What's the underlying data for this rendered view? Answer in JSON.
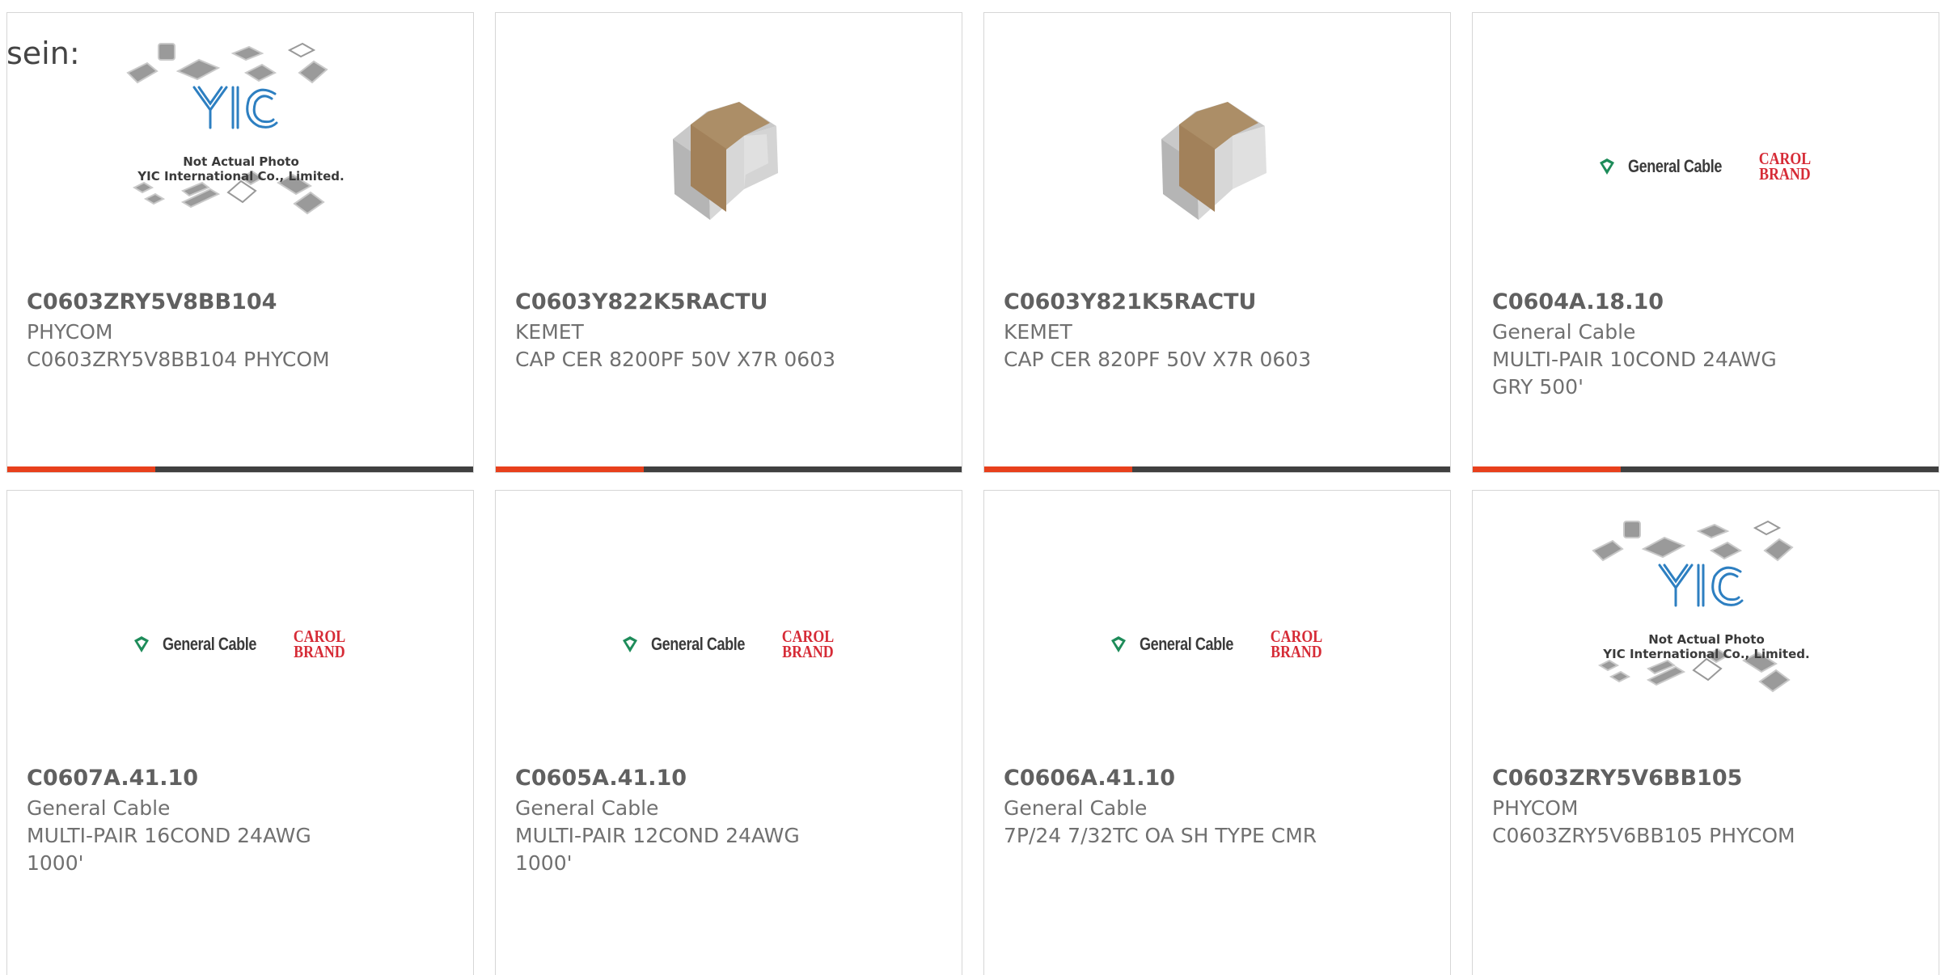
{
  "page": {
    "snippet": "sein:"
  },
  "colors": {
    "accent": "#e8401c",
    "bar_dark": "#404040",
    "border": "#d6d6d6"
  },
  "products": [
    {
      "part_number": "C0603ZRY5V8BB104",
      "manufacturer": "PHYCOM",
      "description": "C0603ZRY5V8BB104 PHYCOM",
      "image": "not-actual-photo-placeholder",
      "placeholder_line1": "Not Actual Photo",
      "placeholder_line2": "YIC International Co., Limited.",
      "placeholder_logo": "YIC"
    },
    {
      "part_number": "C0603Y822K5RACTU",
      "manufacturer": "KEMET",
      "description": "CAP CER 8200PF 50V X7R 0603",
      "image": "ceramic-capacitor-chip"
    },
    {
      "part_number": "C0603Y821K5RACTU",
      "manufacturer": "KEMET",
      "description": "CAP CER 820PF 50V X7R 0603",
      "image": "ceramic-capacitor-chip"
    },
    {
      "part_number": "C0604A.18.10",
      "manufacturer": "General Cable",
      "description": "MULTI-PAIR 10COND 24AWG GRY 500'",
      "image": "general-cable-carol-brand-logo",
      "brand_text": "General Cable",
      "brand2_line1": "CAROL",
      "brand2_line2": "BRAND"
    },
    {
      "part_number": "C0607A.41.10",
      "manufacturer": "General Cable",
      "description": "MULTI-PAIR 16COND 24AWG 1000'",
      "image": "general-cable-carol-brand-logo",
      "brand_text": "General Cable",
      "brand2_line1": "CAROL",
      "brand2_line2": "BRAND"
    },
    {
      "part_number": "C0605A.41.10",
      "manufacturer": "General Cable",
      "description": "MULTI-PAIR 12COND 24AWG 1000'",
      "image": "general-cable-carol-brand-logo",
      "brand_text": "General Cable",
      "brand2_line1": "CAROL",
      "brand2_line2": "BRAND"
    },
    {
      "part_number": "C0606A.41.10",
      "manufacturer": "General Cable",
      "description": "7P/24 7/32TC OA SH TYPE CMR",
      "image": "general-cable-carol-brand-logo",
      "brand_text": "General Cable",
      "brand2_line1": "CAROL",
      "brand2_line2": "BRAND"
    },
    {
      "part_number": "C0603ZRY5V6BB105",
      "manufacturer": "PHYCOM",
      "description": "C0603ZRY5V6BB105 PHYCOM",
      "image": "not-actual-photo-placeholder",
      "placeholder_line1": "Not Actual Photo",
      "placeholder_line2": "YIC International Co., Limited.",
      "placeholder_logo": "YIC"
    }
  ]
}
